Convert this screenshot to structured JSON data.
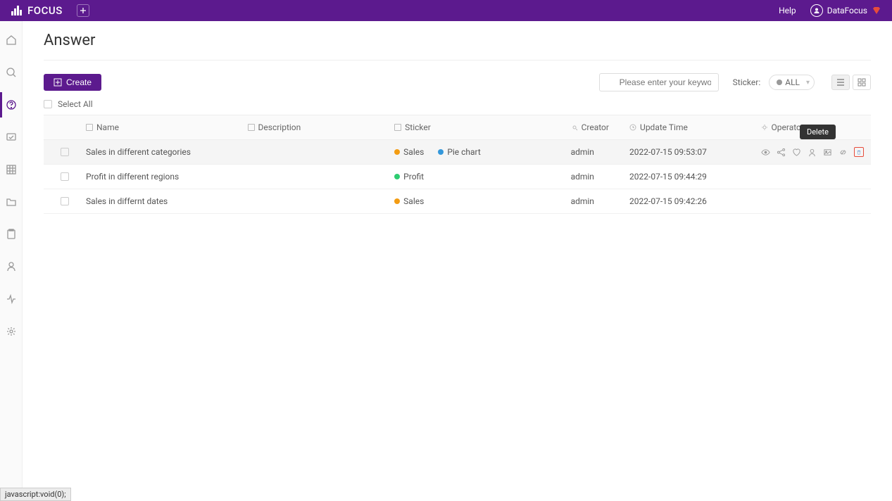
{
  "header": {
    "logo_text": "FOCUS",
    "help_label": "Help",
    "user_name": "DataFocus"
  },
  "page": {
    "title": "Answer"
  },
  "toolbar": {
    "create_label": "Create",
    "search_placeholder": "Please enter your keywo",
    "sticker_label": "Sticker:",
    "sticker_filter": "ALL",
    "select_all_label": "Select All"
  },
  "columns": {
    "name": "Name",
    "description": "Description",
    "sticker": "Sticker",
    "creator": "Creator",
    "update_time": "Update Time",
    "operator": "Operator"
  },
  "rows": [
    {
      "name": "Sales in different categories",
      "stickers": [
        {
          "label": "Sales",
          "color": "orange"
        },
        {
          "label": "Pie chart",
          "color": "blue"
        }
      ],
      "creator": "admin",
      "update_time": "2022-07-15 09:53:07",
      "hovered": true
    },
    {
      "name": "Profit in different regions",
      "stickers": [
        {
          "label": "Profit",
          "color": "green"
        }
      ],
      "creator": "admin",
      "update_time": "2022-07-15 09:44:29",
      "hovered": false
    },
    {
      "name": "Sales in differnt dates",
      "stickers": [
        {
          "label": "Sales",
          "color": "orange"
        }
      ],
      "creator": "admin",
      "update_time": "2022-07-15 09:42:26",
      "hovered": false
    }
  ],
  "tooltip": {
    "delete": "Delete"
  },
  "status_bar": "javascript:void(0);"
}
